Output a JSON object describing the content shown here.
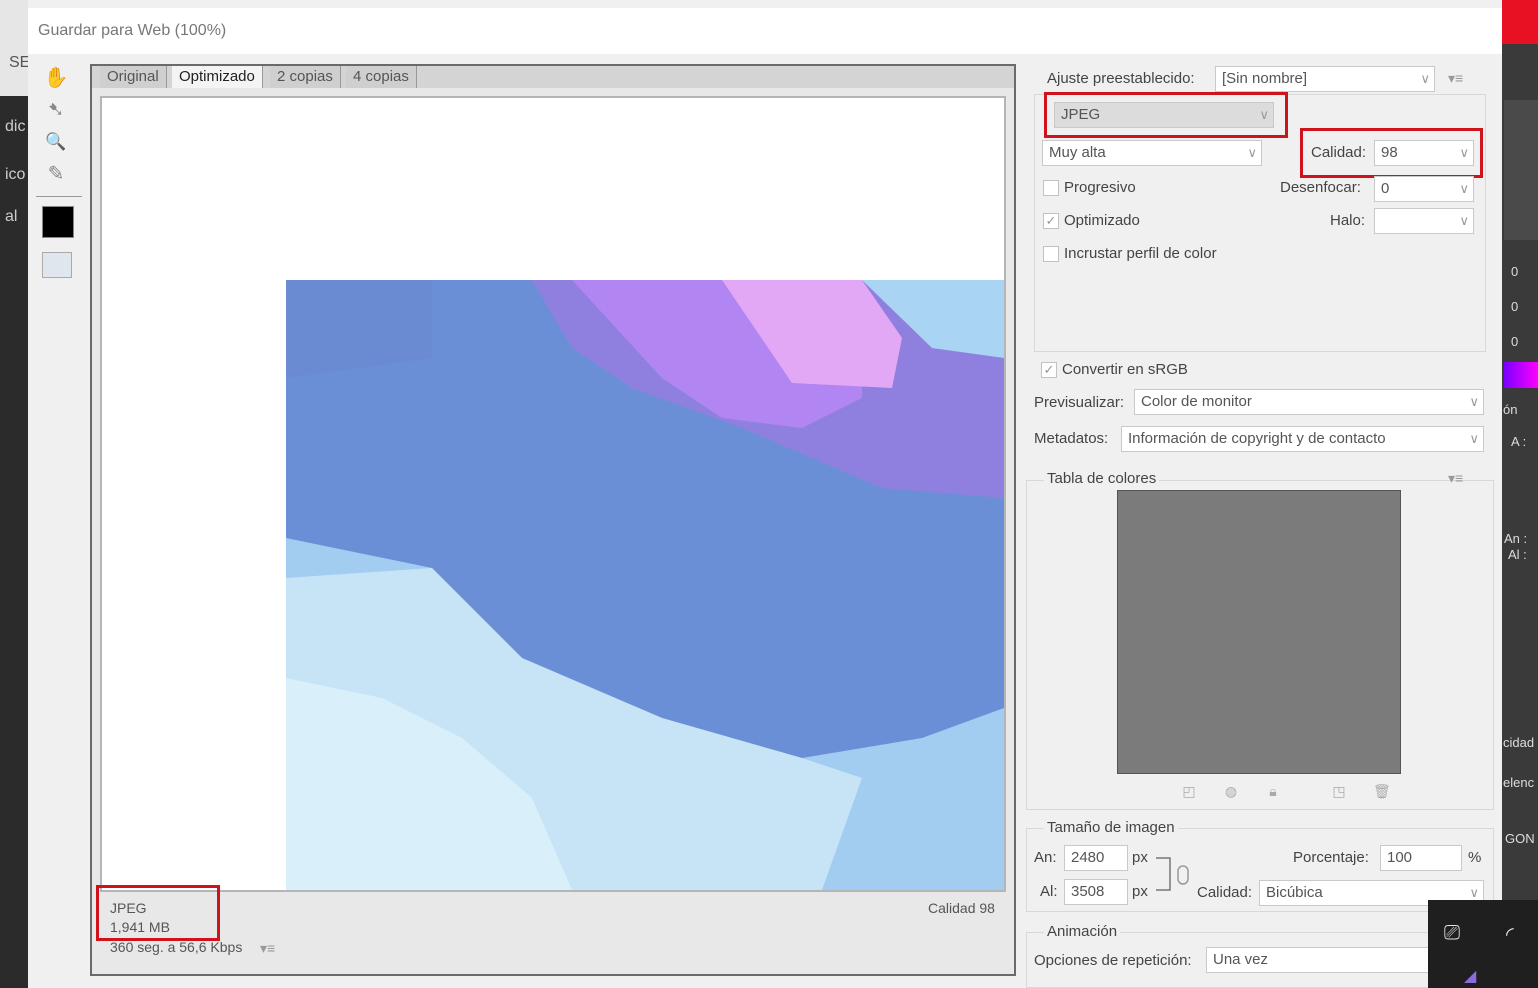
{
  "background_app": {
    "left_letters": [
      "SE",
      "dic",
      "ico",
      "al"
    ],
    "right_values": [
      "0",
      "0",
      "0"
    ],
    "right_labels": [
      "ón",
      "A :",
      "An :",
      "Al :",
      "cidad",
      "elenc",
      "GON"
    ]
  },
  "dialog": {
    "title": "Guardar para Web (100%)"
  },
  "tools": [
    {
      "name": "hand-tool-icon",
      "glyph": "✋"
    },
    {
      "name": "slice-select-tool-icon",
      "glyph": "➷"
    },
    {
      "name": "zoom-tool-icon",
      "glyph": "🔍"
    },
    {
      "name": "eyedropper-tool-icon",
      "glyph": "✎"
    }
  ],
  "eyedropper_color": "#000000",
  "preview": {
    "tabs": [
      "Original",
      "Optimizado",
      "2 copias",
      "4 copias"
    ],
    "active_tab": "Optimizado",
    "status": {
      "format": "JPEG",
      "size": "1,941 MB",
      "time": "360 seg. a 56,6 Kbps",
      "quality": "Calidad 98"
    }
  },
  "settings": {
    "preset_label": "Ajuste preestablecido:",
    "preset_value": "[Sin nombre]",
    "format_value": "JPEG",
    "quality_preset": "Muy alta",
    "quality_label": "Calidad:",
    "quality_value": "98",
    "progressive_label": "Progresivo",
    "progressive_checked": false,
    "blur_label": "Desenfocar:",
    "blur_value": "0",
    "optimized_label": "Optimizado",
    "optimized_checked": true,
    "matte_label": "Halo:",
    "matte_value": "",
    "embed_profile_label": "Incrustar perfil de color",
    "embed_profile_checked": false,
    "convert_srgb_label": "Convertir en sRGB",
    "convert_srgb_checked": true,
    "preview_label": "Previsualizar:",
    "preview_value": "Color de monitor",
    "metadata_label": "Metadatos:",
    "metadata_value": "Información de copyright y de contacto"
  },
  "color_table": {
    "title": "Tabla de colores"
  },
  "image_size": {
    "title": "Tamaño de imagen",
    "width_label": "An:",
    "width_value": "2480",
    "height_label": "Al:",
    "height_value": "3508",
    "unit": "px",
    "percent_label": "Porcentaje:",
    "percent_value": "100",
    "percent_unit": "%",
    "quality_label": "Calidad:",
    "quality_value": "Bicúbica"
  },
  "animation": {
    "title": "Animación",
    "loop_label": "Opciones de repetición:",
    "loop_value": "Una vez"
  },
  "highlight_color": "#d0121b"
}
